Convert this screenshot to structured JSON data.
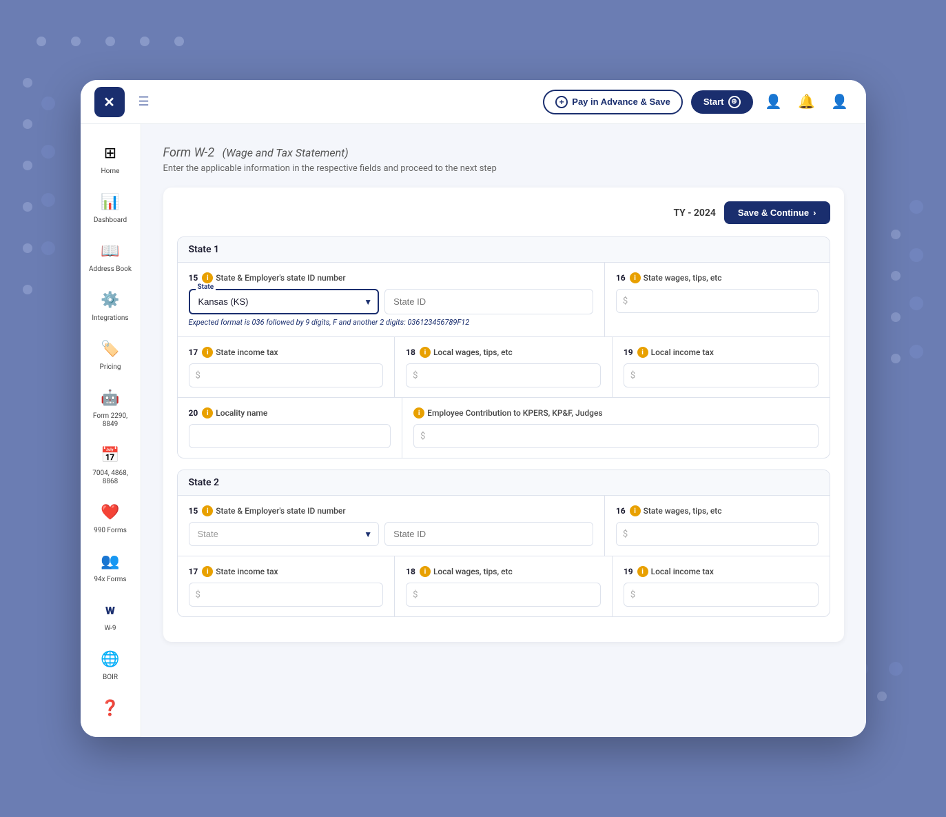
{
  "app": {
    "logo_text": "✕",
    "hamburger_label": "☰"
  },
  "header": {
    "pay_advance_label": "Pay in Advance & Save",
    "start_label": "Start",
    "contacts_icon": "contacts",
    "bell_icon": "bell",
    "user_icon": "user"
  },
  "sidebar": {
    "items": [
      {
        "id": "home",
        "label": "Home",
        "icon": "home"
      },
      {
        "id": "dashboard",
        "label": "Dashboard",
        "icon": "dashboard"
      },
      {
        "id": "address-book",
        "label": "Address Book",
        "icon": "address"
      },
      {
        "id": "integrations",
        "label": "Integrations",
        "icon": "integrations"
      },
      {
        "id": "pricing",
        "label": "Pricing",
        "icon": "pricing"
      },
      {
        "id": "form2290",
        "label": "Form 2290, 8849",
        "icon": "form2290"
      },
      {
        "id": "7004",
        "label": "7004, 4868, 8868",
        "icon": "7004"
      },
      {
        "id": "990forms",
        "label": "990 Forms",
        "icon": "990"
      },
      {
        "id": "94xforms",
        "label": "94x Forms",
        "icon": "94x"
      },
      {
        "id": "w9",
        "label": "W-9",
        "icon": "w9"
      },
      {
        "id": "boir",
        "label": "BOIR",
        "icon": "boir"
      }
    ],
    "help": {
      "label": "Help",
      "icon": "help"
    }
  },
  "page": {
    "title": "Form W-2",
    "title_sub": "(Wage and Tax Statement)",
    "subtitle": "Enter the applicable information in the respective fields and proceed to the next step",
    "ty_label": "TY - 2024",
    "save_continue_label": "Save & Continue"
  },
  "state1": {
    "header": "State 1",
    "field15_number": "15",
    "field15_label": "State & Employer's state ID number",
    "state_select_label": "State",
    "state_value": "Kansas (KS)",
    "state_id_placeholder": "State ID",
    "state_hint": "Expected format is 036 followed by 9 digits, F and another 2 digits: 036123456789F12",
    "field16_number": "16",
    "field16_label": "State wages, tips, etc",
    "field16_placeholder": "$",
    "field17_number": "17",
    "field17_label": "State income tax",
    "field17_placeholder": "$",
    "field18_number": "18",
    "field18_label": "Local wages, tips, etc",
    "field18_placeholder": "$",
    "field19_number": "19",
    "field19_label": "Local income tax",
    "field19_placeholder": "$",
    "field20_number": "20",
    "field20_label": "Locality name",
    "field20_placeholder": "",
    "field_kpers_label": "Employee Contribution to KPERS, KP&F, Judges",
    "field_kpers_placeholder": "$"
  },
  "state2": {
    "header": "State 2",
    "field15_number": "15",
    "field15_label": "State & Employer's state ID number",
    "state_select_placeholder": "State",
    "state_id_placeholder": "State ID",
    "field16_number": "16",
    "field16_label": "State wages, tips, etc",
    "field16_placeholder": "$",
    "field17_number": "17",
    "field17_label": "State income tax",
    "field17_placeholder": "$",
    "field18_number": "18",
    "field18_label": "Local wages, tips, etc",
    "field18_placeholder": "$",
    "field19_number": "19",
    "field19_label": "Local income tax",
    "field19_placeholder": "$"
  },
  "colors": {
    "primary": "#1a2e6e",
    "accent": "#e8a000",
    "border": "#dde2ec",
    "bg": "#f4f6fb",
    "hint": "#1a2e6e"
  }
}
